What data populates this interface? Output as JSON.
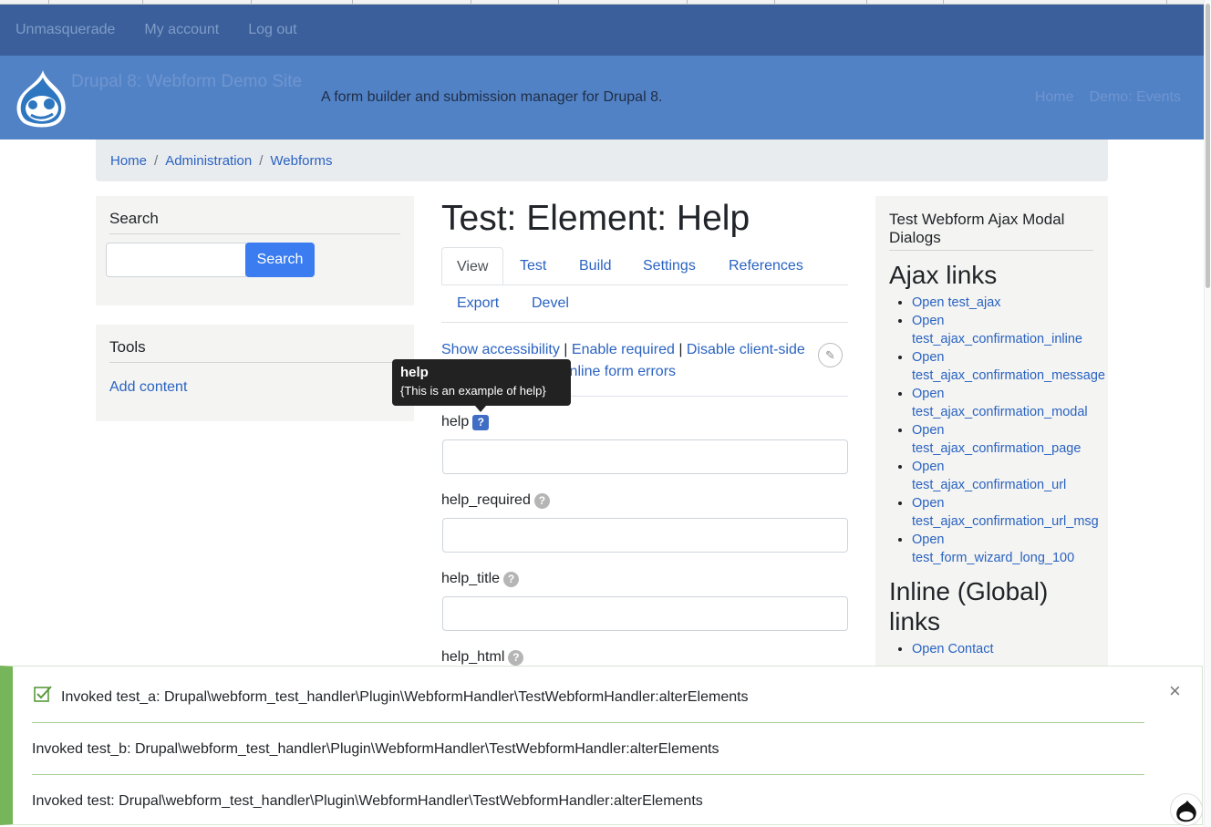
{
  "secondary_nav": [
    "Unmasquerade",
    "My account",
    "Log out"
  ],
  "site": {
    "name": "Drupal 8: Webform Demo Site",
    "slogan": "A form builder and submission manager for Drupal 8.",
    "main_nav": [
      "Home",
      "Demo: Events"
    ]
  },
  "breadcrumb": [
    "Home",
    "Administration",
    "Webforms"
  ],
  "sidebar": {
    "search_title": "Search",
    "search_button": "Search",
    "tools_title": "Tools",
    "tools_link": "Add content"
  },
  "main": {
    "title": "Test: Element: Help",
    "tabs": [
      "View",
      "Test",
      "Build",
      "Settings",
      "References",
      "Export",
      "Devel"
    ],
    "devel_links": {
      "show_accessibility": "Show accessibility",
      "enable_required": "Enable required",
      "disable_client_side": "Disable client-side",
      "inline_form_errors": "inline form errors"
    },
    "fields": [
      "help",
      "help_required",
      "help_title",
      "help_html"
    ],
    "tooltip": {
      "title": "help",
      "body": "{This is an example of help}"
    }
  },
  "right_sidebar": {
    "block_title": "Test Webform Ajax Modal Dialogs",
    "ajax_heading": "Ajax links",
    "ajax_links": [
      "Open test_ajax",
      "Open test_ajax_confirmation_inline",
      "Open test_ajax_confirmation_message",
      "Open test_ajax_confirmation_modal",
      "Open test_ajax_confirmation_page",
      "Open test_ajax_confirmation_url",
      "Open test_ajax_confirmation_url_msg",
      "Open test_form_wizard_long_100"
    ],
    "inline_heading": "Inline (Global) links",
    "inline_links": [
      "Open Contact"
    ]
  },
  "messages": [
    "Invoked test_a: Drupal\\webform_test_handler\\Plugin\\WebformHandler\\TestWebformHandler:alterElements",
    "Invoked test_b: Drupal\\webform_test_handler\\Plugin\\WebformHandler\\TestWebformHandler:alterElements",
    "Invoked test: Drupal\\webform_test_handler\\Plugin\\WebformHandler\\TestWebformHandler:alterElements"
  ],
  "colors": {
    "header": "#5282c6",
    "secondary_nav": "#3a5f9a",
    "link": "#2a63c2",
    "status": "#77b55a"
  },
  "icons": [
    "drupal-logo-icon",
    "pencil-icon",
    "help-icon",
    "check-icon",
    "close-icon"
  ]
}
